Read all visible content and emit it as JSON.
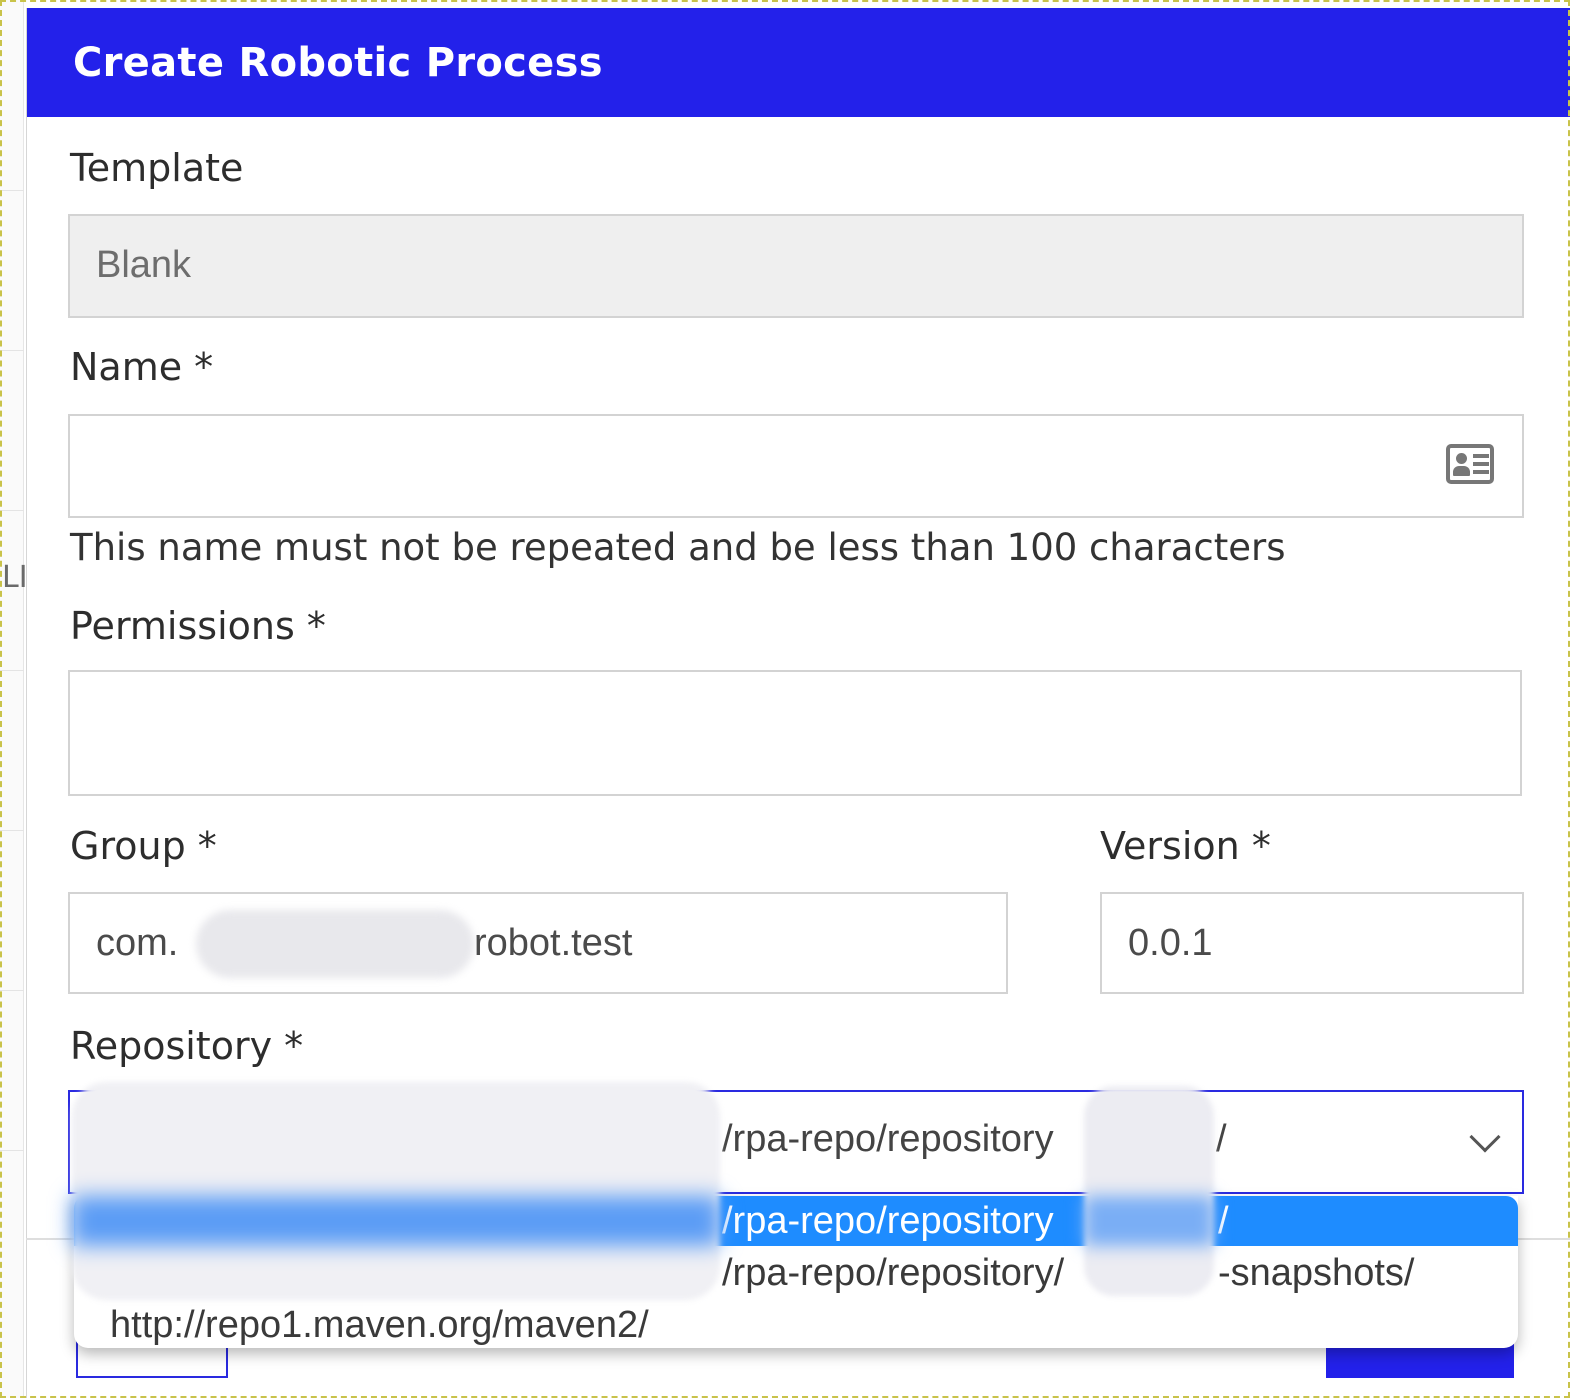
{
  "dialog": {
    "title": "Create Robotic Process"
  },
  "background": {
    "fragment": "LI"
  },
  "form": {
    "template": {
      "label": "Template",
      "value": "Blank"
    },
    "name": {
      "label": "Name *",
      "value": "",
      "icon": "contact-card-icon",
      "hint": "This name must not be repeated and be less than 100 characters"
    },
    "permissions": {
      "label": "Permissions *",
      "value": ""
    },
    "group": {
      "label": "Group *",
      "value_prefix": "com.",
      "value_suffix": "robot.test"
    },
    "version": {
      "label": "Version *",
      "value": "0.0.1"
    },
    "repository": {
      "label": "Repository *",
      "selected_display": "/rpa-repo/repository",
      "selected_trail": "/",
      "options": [
        {
          "text": "/rpa-repo/repository",
          "trail": "/",
          "selected": true
        },
        {
          "text": "/rpa-repo/repository/",
          "trail": "-snapshots/",
          "selected": false
        },
        {
          "text": "http://repo1.maven.org/maven2/",
          "trail": "",
          "selected": false
        }
      ]
    }
  },
  "colors": {
    "header": "#2321ea",
    "select_border": "#2a2ae0",
    "option_selected": "#1e8cff"
  }
}
